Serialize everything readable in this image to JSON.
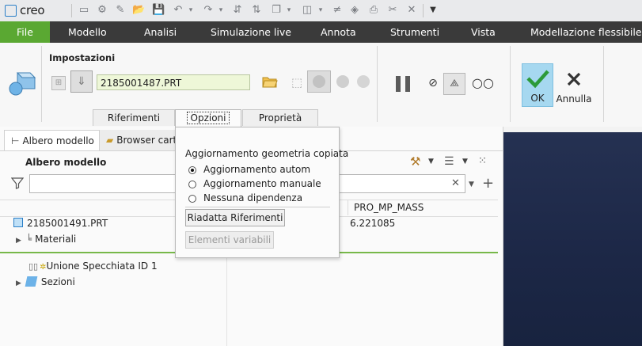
{
  "app": {
    "logo_text": "creo"
  },
  "menu": {
    "file": "File",
    "items": [
      "Modello",
      "Analisi",
      "Simulazione live",
      "Annota",
      "Strumenti",
      "Vista",
      "Modellazione flessibile"
    ]
  },
  "ribbon": {
    "group_title": "Impostazioni",
    "reference_model": "2185001487.PRT",
    "tabs": [
      "Riferimenti",
      "Opzioni",
      "Proprietà"
    ],
    "active_tab": "Opzioni",
    "ok_label": "OK",
    "cancel_label": "Annulla"
  },
  "panel": {
    "tabs": {
      "tree": "Albero modello",
      "browser": "Browser cart"
    },
    "tree_title": "Albero modello",
    "column_header": "PRO_MP_MASS",
    "rows": [
      {
        "label": "2185001491.PRT",
        "value": "6.221085"
      },
      {
        "label": "Materiali"
      },
      {
        "label": "Unione Specchiata ID 1"
      },
      {
        "label": "Sezioni"
      }
    ]
  },
  "popup": {
    "title": "Aggiornamento geometria copiata",
    "options": [
      "Aggiornamento autom",
      "Aggiornamento manuale",
      "Nessuna dipendenza"
    ],
    "selected_index": 0,
    "button_readapt": "Riadatta Riferimenti",
    "button_variable": "Elementi variabili"
  },
  "colors": {
    "accent_green": "#5aa832",
    "menubar": "#3a3a3a",
    "ok_blue": "#a6d8f0",
    "graphics_bg": "#1e2a45"
  }
}
